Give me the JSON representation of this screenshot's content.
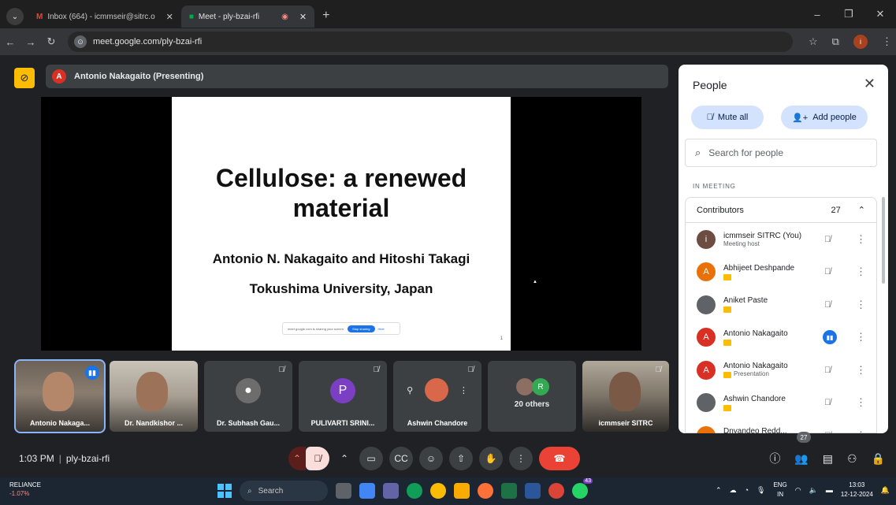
{
  "browser": {
    "tabs": [
      {
        "label": "Inbox (664) - icmmseir@sitrc.o",
        "icon": "gmail-icon"
      },
      {
        "label": "Meet - ply-bzai-rfi",
        "icon": "meet-icon"
      }
    ],
    "url": "meet.google.com/ply-bzai-rfi"
  },
  "presenter_bar": {
    "avatar": "A",
    "label": "Antonio Nakagaito (Presenting)"
  },
  "slide": {
    "title_line1": "Cellulose: a renewed",
    "title_line2": "material",
    "authors": "Antonio N. Nakagaito and Hitoshi Takagi",
    "university": "Tokushima University, Japan",
    "share_text": "meet.google.com is sharing your screen.",
    "stop_label": "Stop sharing",
    "hide_label": "Hide",
    "page_number": "1"
  },
  "tiles": [
    {
      "name": "Antonio Nakaga..."
    },
    {
      "name": "Dr. Nandkishor ..."
    },
    {
      "name": "Dr. Subhash Gau..."
    },
    {
      "name": "PULIVARTI SRINI...",
      "avatar": "P"
    },
    {
      "name": "Ashwin Chandore"
    },
    {
      "name": "20 others",
      "avatar": "R"
    },
    {
      "name": "icmmseir SITRC"
    }
  ],
  "meeting": {
    "time": "1:03 PM",
    "code": "ply-bzai-rfi",
    "people_count": "27"
  },
  "people_panel": {
    "title": "People",
    "mute_all": "Mute all",
    "add_people": "Add people",
    "search_placeholder": "Search for people",
    "section_label": "IN MEETING",
    "group_label": "Contributors",
    "group_count": "27",
    "participants": [
      {
        "initial": "i",
        "color": "#6d4c41",
        "name": "icmmseir SITRC (You)",
        "sub": "Meeting host"
      },
      {
        "initial": "A",
        "color": "#e8710a",
        "name": "Abhijeet Deshpande",
        "sub": ""
      },
      {
        "initial": "",
        "color": "#5f6368",
        "name": "Aniket Paste",
        "sub": ""
      },
      {
        "initial": "A",
        "color": "#d93025",
        "name": "Antonio Nakagaito",
        "sub": ""
      },
      {
        "initial": "A",
        "color": "#d93025",
        "name": "Antonio Nakagaito",
        "sub": "Presentation"
      },
      {
        "initial": "",
        "color": "#5f6368",
        "name": "Ashwin Chandore",
        "sub": ""
      },
      {
        "initial": "",
        "color": "#e8710a",
        "name": "Dnyandeo Redd...",
        "sub": ""
      }
    ]
  },
  "taskbar": {
    "stock_name": "RELIANCE",
    "stock_change": "-1.07%",
    "search_label": "Search",
    "whatsapp_badge": "43",
    "lang_line1": "ENG",
    "lang_line2": "IN",
    "clock_time": "13:03",
    "clock_date": "12-12-2024"
  }
}
